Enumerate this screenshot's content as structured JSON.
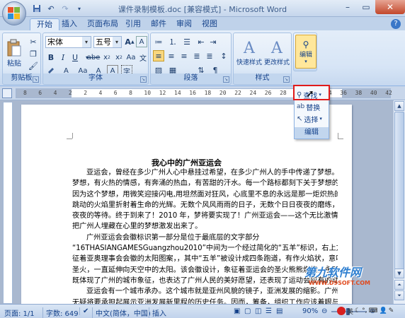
{
  "window": {
    "title": "课件录制模板.doc [兼容模式] - Microsoft Word",
    "minimize_icon": "minimize-icon",
    "maximize_icon": "maximize-icon",
    "close_icon": "close-icon"
  },
  "quick_access": [
    "save-icon",
    "undo-icon",
    "redo-icon",
    "customize-icon"
  ],
  "tabs": [
    {
      "label": "开始",
      "active": true
    },
    {
      "label": "插入",
      "active": false
    },
    {
      "label": "页面布局",
      "active": false
    },
    {
      "label": "引用",
      "active": false
    },
    {
      "label": "邮件",
      "active": false
    },
    {
      "label": "审阅",
      "active": false
    },
    {
      "label": "视图",
      "active": false
    }
  ],
  "ribbon": {
    "clipboard": {
      "label": "剪贴板",
      "paste_label": "粘贴"
    },
    "font": {
      "label": "字体",
      "font_name": "宋体",
      "font_size": "五号",
      "clear_label": "A",
      "char_border": "A",
      "phonetic": "文",
      "change_case": "Aa",
      "char_shade": "A"
    },
    "paragraph": {
      "label": "段落"
    },
    "styles": {
      "label": "样式",
      "quick_styles": "快速样式",
      "change_styles": "更改样式"
    },
    "editing": {
      "label": "编辑"
    }
  },
  "edit_menu": {
    "find": "查找",
    "replace": "替换",
    "select": "选择",
    "label": "编辑"
  },
  "ruler_numbers": [
    "8",
    "6",
    "4",
    "2",
    "2",
    "4",
    "6",
    "8",
    "10",
    "12",
    "14",
    "16",
    "18",
    "20",
    "22",
    "24",
    "26",
    "28",
    "30",
    "32",
    "34",
    "36",
    "38",
    "40",
    "42"
  ],
  "document": {
    "title": "我心中的广州亚运会",
    "lines": [
      "亚运会，曾经在多少广州人心中悬挂过希望，在多少广州人的手中传递了梦想。因为这个",
      "梦想，有火热的情感，有奔涌的热血，有苦甜的汗水。每一个路标都刻下关于梦想的诗言；",
      "因为这个梦想，用微笑迎接闪电,用坦然面对狂风，心底里不息的永远是那一炬炽热的火炬，",
      "跳动的火焰里折射着生命的光辉。无数个风风雨雨的日子，无数个日日夜夜的磨练，无数个日日",
      "夜夜的等待。终于到来了！2010 年，梦将要实现了！广州亚运会——这个无比激情的梦想，",
      "把广州人埋藏在心里的梦想激发出来了。",
      "广州亚运会会徽标识第一部分是位于最底层的文字部分",
      "“16THASIANGAMESGuangzhou2010”中间为一个经过简化的“五羊”标识，右上方是一个象",
      "征着亚奥理事会会徽的太阳图案，，其中“五羊”被设计成四条跑道，有作火焰状，意味亚运",
      "圣火，一直延伸向天空中的太阳。该会徽设计，象征着亚运会的圣火熊熊燃烧，永不熄灭。",
      "既体现了广州的城市象征，也表达了广州人民的美好愿望，还表现了运动会应有的动感。",
      "亚运会有一个城市承办。这个城市就是亚州风貌的镜子，亚洲发展的缩影。广州亚运会",
      "无疑将要承担起展示亚洲发展新里程的历史任务。因而，筹备，组织工作应该着眼与体现新"
    ]
  },
  "status": {
    "page": "页面: 1/1",
    "words": "字数: 649",
    "language": "中文(简体，中国)",
    "mode": "插入",
    "zoom": "90%"
  },
  "watermark": {
    "text": "第九软件网",
    "url": "WWW.D9SOFT.COM"
  }
}
